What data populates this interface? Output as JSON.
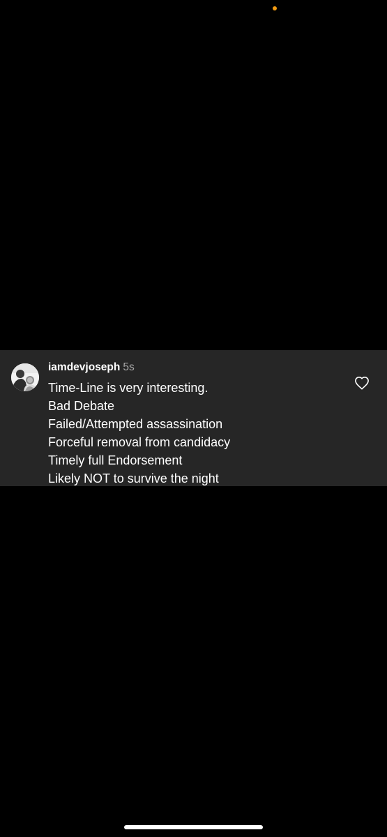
{
  "colors": {
    "background": "#000000",
    "comment_card_bg": "#262626",
    "username": "#ffffff",
    "timestamp": "#a8a8a8",
    "text": "#ffffff",
    "privacy_dot": "#f39c12",
    "home_indicator": "#ffffff"
  },
  "status_bar": {
    "privacy_indicator": "orange-dot"
  },
  "comment": {
    "avatar_icon": "user-avatar",
    "username": "iamdevjoseph",
    "timestamp": "5s",
    "lines": [
      "Time-Line is very interesting.",
      "Bad Debate",
      "Failed/Attempted assassination",
      "Forceful removal from candidacy",
      "Timely full Endorsement",
      "Likely NOT to survive the night"
    ],
    "like_icon": "heart-outline-icon"
  }
}
